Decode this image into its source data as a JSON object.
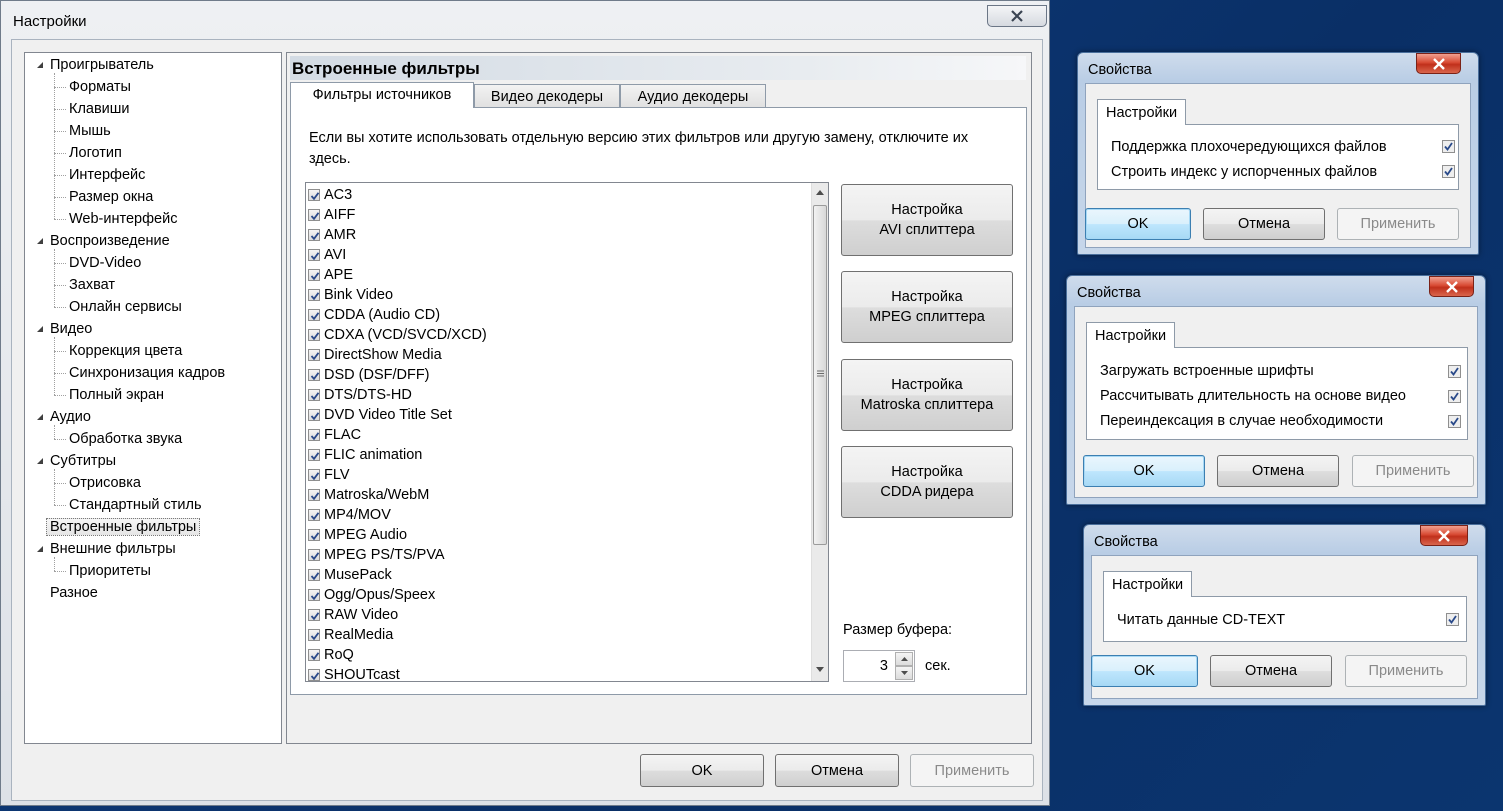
{
  "main_window": {
    "title": "Настройки",
    "tree": [
      {
        "label": "Проигрыватель",
        "level": 0,
        "expanded": true
      },
      {
        "label": "Форматы",
        "level": 1
      },
      {
        "label": "Клавиши",
        "level": 1
      },
      {
        "label": "Мышь",
        "level": 1
      },
      {
        "label": "Логотип",
        "level": 1
      },
      {
        "label": "Интерфейс",
        "level": 1
      },
      {
        "label": "Размер окна",
        "level": 1
      },
      {
        "label": "Web-интерфейс",
        "level": 1
      },
      {
        "label": "Воспроизведение",
        "level": 0,
        "expanded": true
      },
      {
        "label": "DVD-Video",
        "level": 1
      },
      {
        "label": "Захват",
        "level": 1
      },
      {
        "label": "Онлайн сервисы",
        "level": 1
      },
      {
        "label": "Видео",
        "level": 0,
        "expanded": true
      },
      {
        "label": "Коррекция цвета",
        "level": 1
      },
      {
        "label": "Синхронизация кадров",
        "level": 1
      },
      {
        "label": "Полный экран",
        "level": 1
      },
      {
        "label": "Аудио",
        "level": 0,
        "expanded": true
      },
      {
        "label": "Обработка звука",
        "level": 1
      },
      {
        "label": "Субтитры",
        "level": 0,
        "expanded": true
      },
      {
        "label": "Отрисовка",
        "level": 1
      },
      {
        "label": "Стандартный стиль",
        "level": 1
      },
      {
        "label": "Встроенные фильтры",
        "level": 0,
        "selected": true
      },
      {
        "label": "Внешние фильтры",
        "level": 0,
        "expanded": true
      },
      {
        "label": "Приоритеты",
        "level": 1
      },
      {
        "label": "Разное",
        "level": 0
      }
    ],
    "panel_title": "Встроенные фильтры",
    "tabs": [
      "Фильтры источников",
      "Видео декодеры",
      "Аудио декодеры"
    ],
    "description": "Если вы хотите использовать отдельную версию этих фильтров или другую замену, отключите их здесь.",
    "filters": [
      "AC3",
      "AIFF",
      "AMR",
      "AVI",
      "APE",
      "Bink Video",
      "CDDA (Audio CD)",
      "CDXA (VCD/SVCD/XCD)",
      "DirectShow Media",
      "DSD (DSF/DFF)",
      "DTS/DTS-HD",
      "DVD Video Title Set",
      "FLAC",
      "FLIC animation",
      "FLV",
      "Matroska/WebM",
      "MP4/MOV",
      "MPEG Audio",
      "MPEG PS/TS/PVA",
      "MusePack",
      "Ogg/Opus/Speex",
      "RAW Video",
      "RealMedia",
      "RoQ",
      "SHOUTcast"
    ],
    "splitter_buttons": [
      [
        "Настройка",
        "AVI сплиттера"
      ],
      [
        "Настройка",
        "MPEG сплиттера"
      ],
      [
        "Настройка",
        "Matroska сплиттера"
      ],
      [
        "Настройка",
        "CDDA ридера"
      ]
    ],
    "buffer_label": "Размер буфера:",
    "buffer_value": "3",
    "buffer_unit": "сек.",
    "ok": "OK",
    "cancel": "Отмена",
    "apply": "Применить"
  },
  "dialogs": [
    {
      "title": "Свойства",
      "tab": "Настройки",
      "options": [
        "Поддержка плохочередующихся файлов",
        "Строить индекс у испорченных файлов"
      ],
      "ok": "OK",
      "cancel": "Отмена",
      "apply": "Применить"
    },
    {
      "title": "Свойства",
      "tab": "Настройки",
      "options": [
        "Загружать встроенные шрифты",
        "Рассчитывать длительность на основе видео",
        "Переиндексация в случае необходимости"
      ],
      "ok": "OK",
      "cancel": "Отмена",
      "apply": "Применить"
    },
    {
      "title": "Свойства",
      "tab": "Настройки",
      "options": [
        "Читать данные CD-TEXT"
      ],
      "ok": "OK",
      "cancel": "Отмена",
      "apply": "Применить"
    }
  ],
  "colors": {
    "desktop": "#0d3a78",
    "close_red": "#c0301b",
    "default_button": "#3c7fb1"
  },
  "icons": [
    "close-icon",
    "expand-arrow-icon",
    "checkbox-checked-icon",
    "scroll-up-icon",
    "scroll-down-icon",
    "spin-up-icon",
    "spin-down-icon"
  ]
}
